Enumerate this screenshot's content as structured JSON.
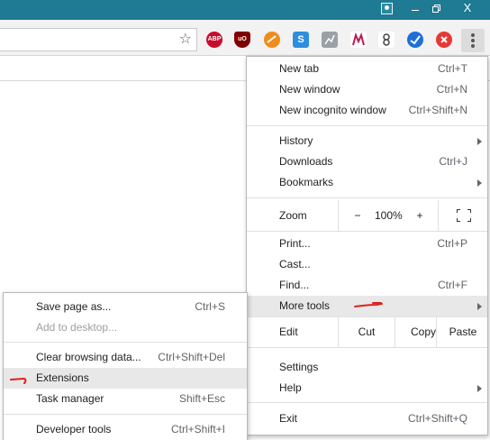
{
  "titlebar": {
    "profile_icon": "person-icon",
    "minimize_icon": "minimize-icon",
    "restore_icon": "restore-icon",
    "close_label": "X"
  },
  "toolbar": {
    "bookmark_icon": "star-icon",
    "extensions": [
      {
        "name": "adblock-plus-icon",
        "label": "ABP"
      },
      {
        "name": "ublock-origin-icon",
        "label": "uO"
      },
      {
        "name": "orange-extension-icon",
        "label": ""
      },
      {
        "name": "s-extension-icon",
        "label": "S"
      },
      {
        "name": "gray-extension-icon",
        "label": ""
      },
      {
        "name": "m-extension-icon",
        "label": ""
      },
      {
        "name": "sketch-extension-icon",
        "label": ""
      },
      {
        "name": "blue-check-extension-icon",
        "label": ""
      },
      {
        "name": "red-x-extension-icon",
        "label": ""
      }
    ],
    "menu_icon": "kebab-menu-icon"
  },
  "main_menu": {
    "new_tab": {
      "label": "New tab",
      "shortcut": "Ctrl+T"
    },
    "new_window": {
      "label": "New window",
      "shortcut": "Ctrl+N"
    },
    "new_incognito": {
      "label": "New incognito window",
      "shortcut": "Ctrl+Shift+N"
    },
    "history": {
      "label": "History"
    },
    "downloads": {
      "label": "Downloads",
      "shortcut": "Ctrl+J"
    },
    "bookmarks": {
      "label": "Bookmarks"
    },
    "zoom": {
      "label": "Zoom",
      "minus": "−",
      "value": "100%",
      "plus": "+"
    },
    "print": {
      "label": "Print...",
      "shortcut": "Ctrl+P"
    },
    "cast": {
      "label": "Cast..."
    },
    "find": {
      "label": "Find...",
      "shortcut": "Ctrl+F"
    },
    "more_tools": {
      "label": "More tools"
    },
    "edit": {
      "label": "Edit",
      "cut": "Cut",
      "copy": "Copy",
      "paste": "Paste"
    },
    "settings": {
      "label": "Settings"
    },
    "help": {
      "label": "Help"
    },
    "exit": {
      "label": "Exit",
      "shortcut": "Ctrl+Shift+Q"
    }
  },
  "sub_menu": {
    "save_page": {
      "label": "Save page as...",
      "shortcut": "Ctrl+S"
    },
    "add_to_desktop": {
      "label": "Add to desktop..."
    },
    "clear_browsing": {
      "label": "Clear browsing data...",
      "shortcut": "Ctrl+Shift+Del"
    },
    "extensions": {
      "label": "Extensions"
    },
    "task_manager": {
      "label": "Task manager",
      "shortcut": "Shift+Esc"
    },
    "developer_tools": {
      "label": "Developer tools",
      "shortcut": "Ctrl+Shift+I"
    }
  },
  "colors": {
    "titlebar": "#1f7a93",
    "annotation": "#e0201c",
    "highlight": "#e8e8e8"
  }
}
